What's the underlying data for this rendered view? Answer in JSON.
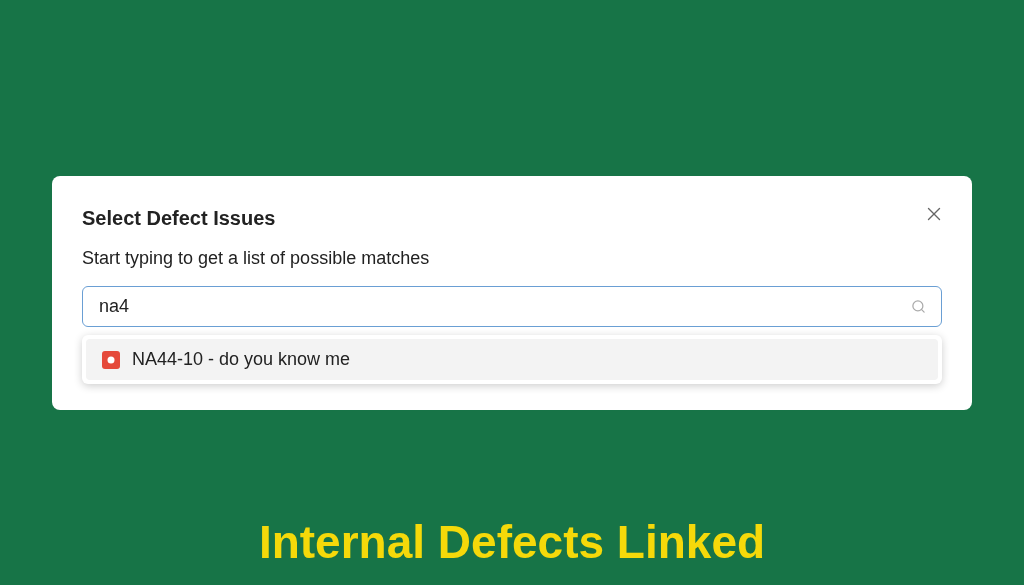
{
  "dialog": {
    "title": "Select Defect Issues",
    "hint": "Start typing to get a list of possible matches",
    "search": {
      "value": "na4"
    },
    "results": [
      {
        "label": "NA44-10 - do you know me",
        "selected": true
      }
    ]
  },
  "caption": "Internal Defects Linked"
}
